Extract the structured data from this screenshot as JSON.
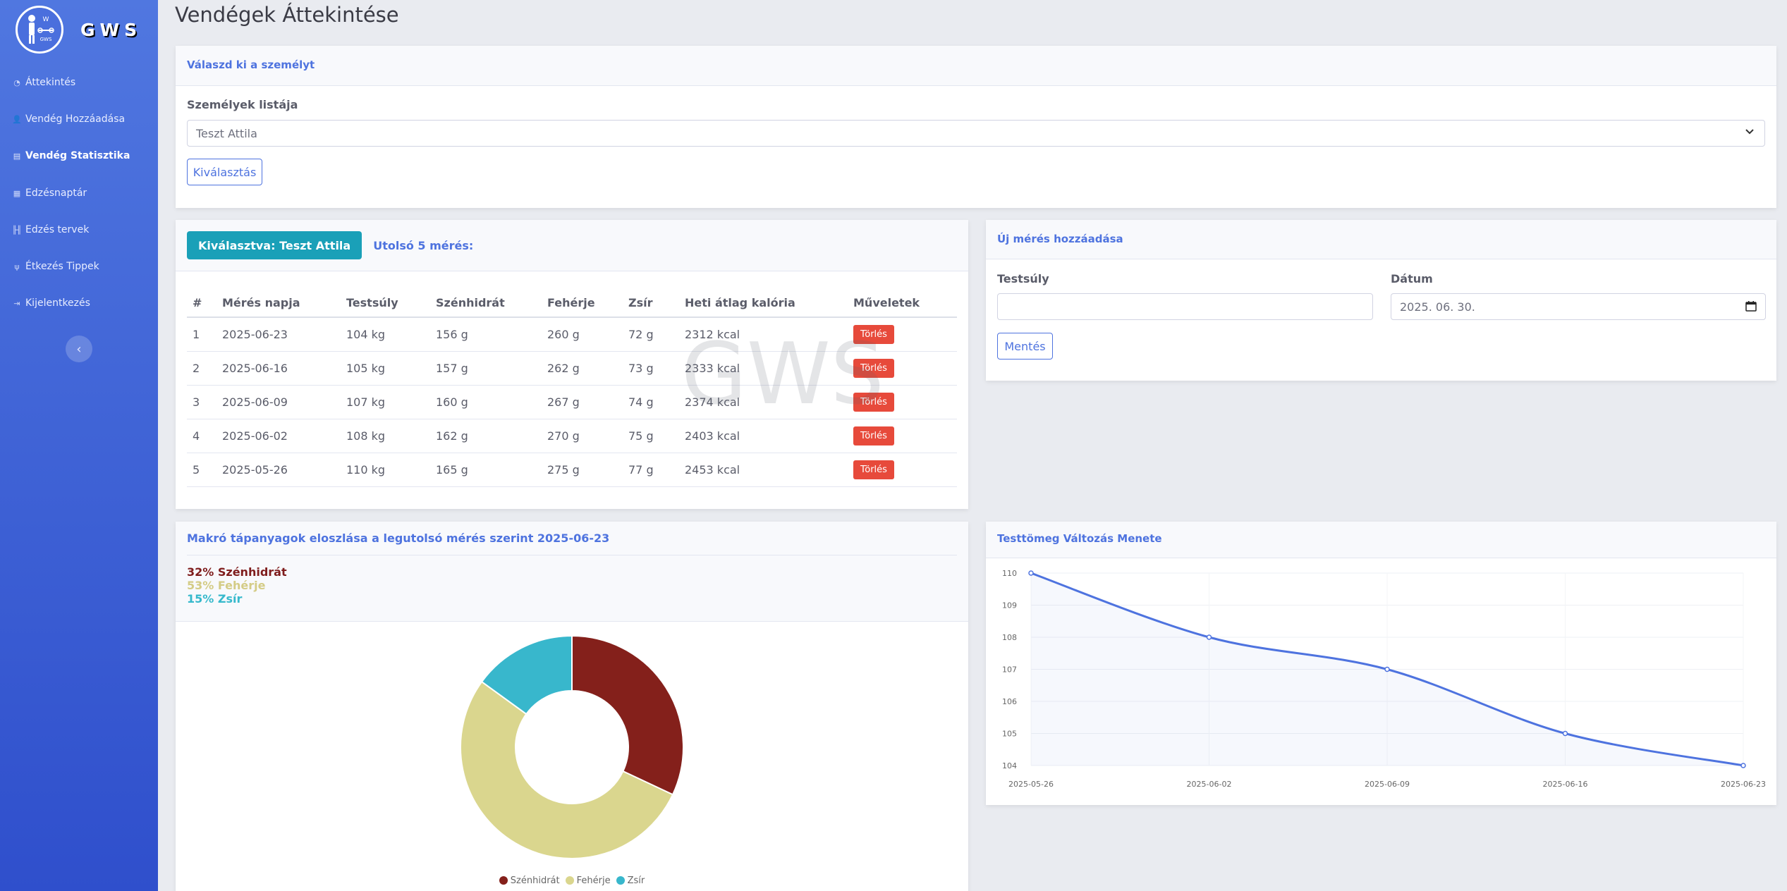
{
  "brand": {
    "name": "GWS",
    "logo_text": "GWS"
  },
  "sidebar": {
    "items": [
      {
        "label": "Áttekintés",
        "icon": "gauge-icon"
      },
      {
        "label": "Vendég Hozzáadása",
        "icon": "user-plus-icon"
      },
      {
        "label": "Vendég Statisztika",
        "icon": "id-card-icon"
      },
      {
        "label": "Edzésnaptár",
        "icon": "calendar-icon"
      },
      {
        "label": "Edzés tervek",
        "icon": "dumbbell-icon"
      },
      {
        "label": "Étkezés Tippek",
        "icon": "utensils-icon"
      },
      {
        "label": "Kijelentkezés",
        "icon": "logout-icon"
      }
    ],
    "active_index": 2,
    "collapse_symbol": "‹"
  },
  "page": {
    "title": "Vendégek Áttekintése"
  },
  "select_card": {
    "header": "Válaszd ki a személyt",
    "list_label": "Személyek listája",
    "selected_person": "Teszt Attila",
    "select_button": "Kiválasztás"
  },
  "measurements": {
    "selected_label": "Kiválasztva: Teszt Attila",
    "last_label": "Utolsó 5 mérés:",
    "columns": [
      "#",
      "Mérés napja",
      "Testsúly",
      "Szénhidrát",
      "Fehérje",
      "Zsír",
      "Heti átlag kalória",
      "Műveletek"
    ],
    "rows": [
      [
        "1",
        "2025-06-23",
        "104 kg",
        "156 g",
        "260 g",
        "72 g",
        "2312 kcal"
      ],
      [
        "2",
        "2025-06-16",
        "105 kg",
        "157 g",
        "262 g",
        "73 g",
        "2333 kcal"
      ],
      [
        "3",
        "2025-06-09",
        "107 kg",
        "160 g",
        "267 g",
        "74 g",
        "2374 kcal"
      ],
      [
        "4",
        "2025-06-02",
        "108 kg",
        "162 g",
        "270 g",
        "75 g",
        "2403 kcal"
      ],
      [
        "5",
        "2025-05-26",
        "110 kg",
        "165 g",
        "275 g",
        "77 g",
        "2453 kcal"
      ]
    ],
    "delete_label": "Törlés",
    "watermark": "GWS"
  },
  "new_measurement": {
    "header": "Új mérés hozzáadása",
    "weight_label": "Testsúly",
    "weight_value": "",
    "date_label": "Dátum",
    "date_value": "2025. 06. 30.",
    "save_button": "Mentés"
  },
  "macro_card": {
    "title": "Makró tápanyagok eloszlása a legutolsó mérés szerint 2025-06-23",
    "lines": [
      {
        "text": "32% Szénhidrát",
        "color": "#7f1d1d"
      },
      {
        "text": "53% Fehérje",
        "color": "#d4cc86"
      },
      {
        "text": "15% Zsír",
        "color": "#36b9cc"
      }
    ]
  },
  "weight_card": {
    "title": "Testtömeg Változás Menete"
  },
  "chart_data": [
    {
      "type": "pie",
      "categories": [
        "Szénhidrát",
        "Fehérje",
        "Zsír"
      ],
      "values": [
        32,
        53,
        15
      ],
      "colors": [
        "#84201b",
        "#dad68e",
        "#38b7cc"
      ],
      "legend_position": "bottom",
      "donut": true
    },
    {
      "type": "line",
      "x": [
        "2025-05-26",
        "2025-06-02",
        "2025-06-09",
        "2025-06-16",
        "2025-06-23"
      ],
      "series": [
        {
          "values": [
            110,
            108,
            107,
            105,
            104
          ]
        }
      ],
      "ylim": [
        104,
        110
      ],
      "yticks": [
        104,
        105,
        106,
        107,
        108,
        109,
        110
      ],
      "grid": true,
      "color": "#4e73df"
    }
  ]
}
